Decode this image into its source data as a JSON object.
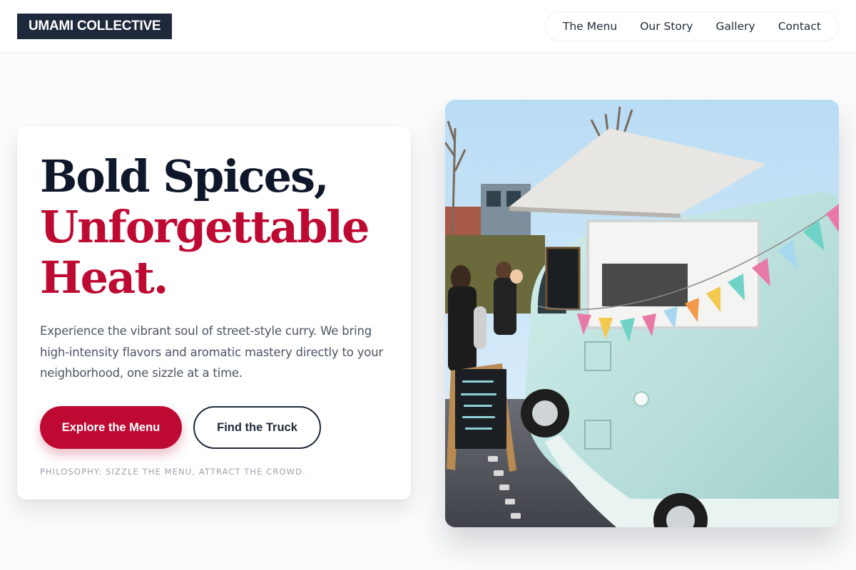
{
  "header": {
    "logo_text": "UMAMI COLLECTIVE",
    "nav": [
      {
        "label": "The Menu"
      },
      {
        "label": "Our Story"
      },
      {
        "label": "Gallery"
      },
      {
        "label": "Contact"
      }
    ]
  },
  "hero": {
    "headline_line1": "Bold Spices,",
    "headline_line2": "Unforgettable",
    "headline_line3": "Heat.",
    "description": "Experience the vibrant soul of street-style curry. We bring high-intensity flavors and aromatic mastery directly to your neighborhood, one sizzle at a time.",
    "primary_cta": "Explore the Menu",
    "secondary_cta": "Find the Truck",
    "philosophy": "PHILOSOPHY: SIZZLE THE MENU, ATTRACT THE CROWD."
  },
  "image": {
    "alt": "Mint-green vintage food truck with colorful bunting and a chalkboard sign"
  },
  "colors": {
    "brand_dark": "#1e293b",
    "accent_red": "#be0a33",
    "truck_mint": "#bfe3df"
  }
}
